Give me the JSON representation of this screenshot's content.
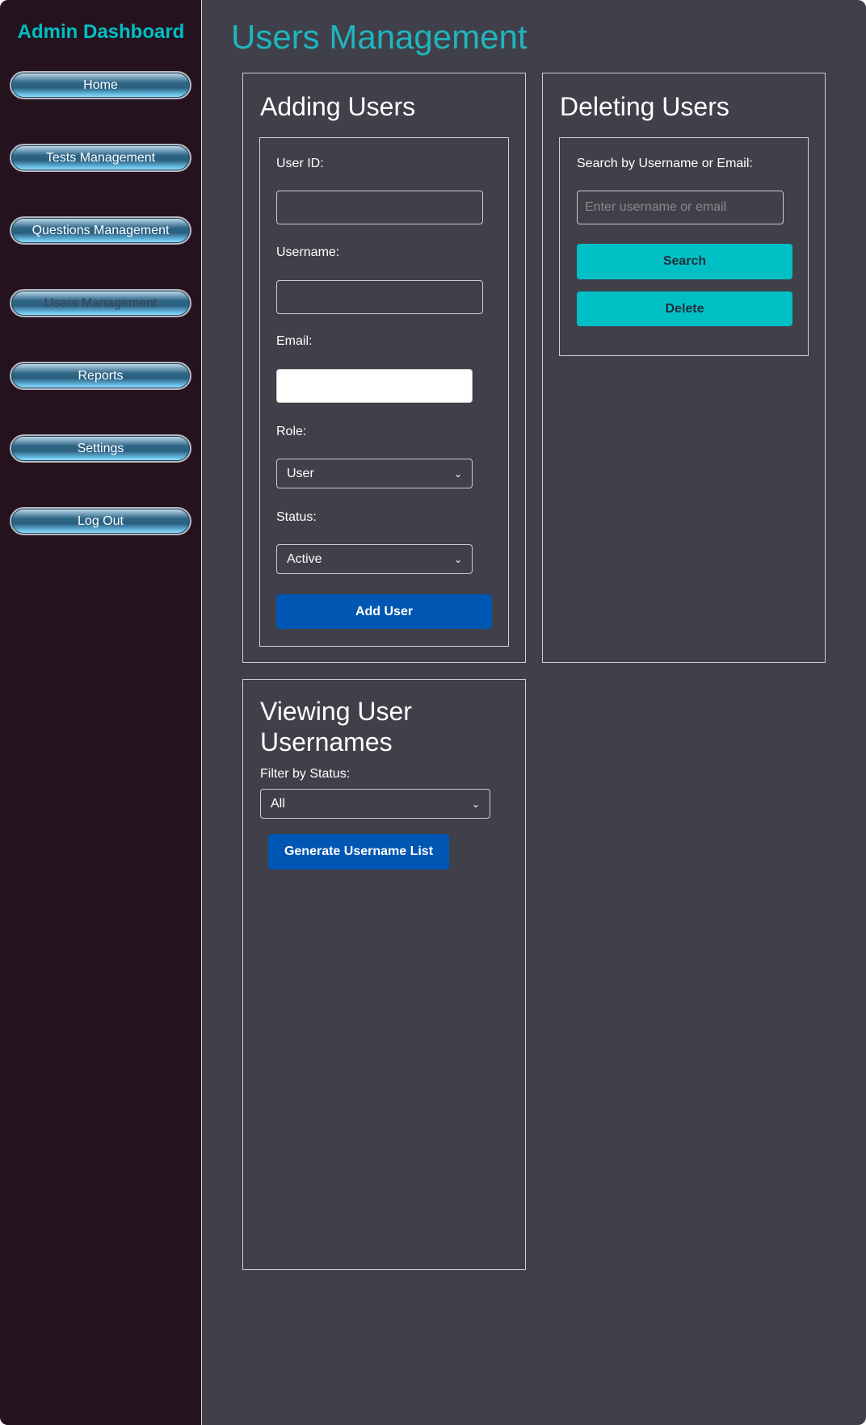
{
  "sidebar": {
    "title": "Admin Dashboard",
    "items": [
      {
        "label": "Home"
      },
      {
        "label": "Tests Management"
      },
      {
        "label": "Questions Management"
      },
      {
        "label": "Users Management",
        "active": true
      },
      {
        "label": "Reports"
      },
      {
        "label": "Settings"
      },
      {
        "label": "Log Out"
      }
    ]
  },
  "page_title": "Users Management",
  "adding": {
    "title": "Adding Users",
    "user_id_label": "User ID:",
    "username_label": "Username:",
    "email_label": "Email:",
    "role_label": "Role:",
    "role_value": "User",
    "status_label": "Status:",
    "status_value": "Active",
    "submit": "Add User"
  },
  "deleting": {
    "title": "Deleting Users",
    "search_label": "Search by Username or Email:",
    "search_placeholder": "Enter username or email",
    "search_button": "Search",
    "delete_button": "Delete"
  },
  "viewing": {
    "title": "Viewing User Usernames",
    "filter_label": "Filter by Status:",
    "filter_value": "All",
    "generate_button": "Generate Username List"
  },
  "colors": {
    "accent": "#00c0c6",
    "primary": "#0057b3",
    "sidebar": "#24131f",
    "main": "#40404a"
  }
}
